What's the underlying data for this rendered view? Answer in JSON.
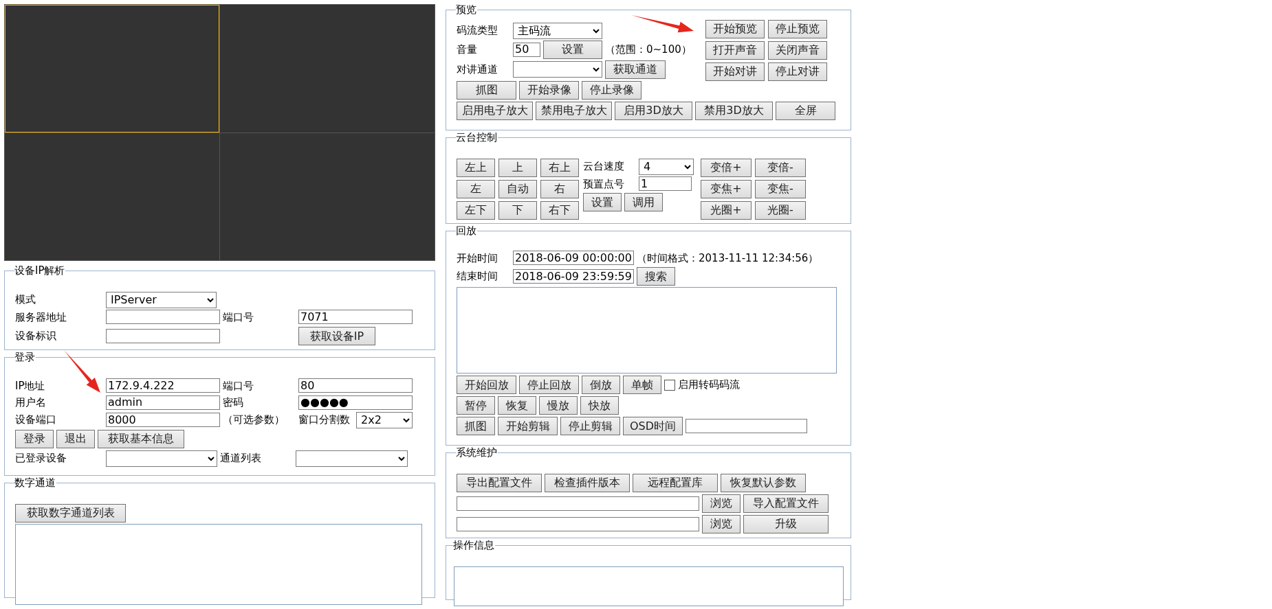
{
  "video_windows": [
    {
      "selected": true
    },
    {
      "selected": false
    },
    {
      "selected": false
    },
    {
      "selected": false
    }
  ],
  "device_ip": {
    "title": "设备IP解析",
    "mode_label": "模式",
    "mode_value": "IPServer",
    "server_label": "服务器地址",
    "port_label": "端口号",
    "port_value": "7071",
    "device_id_label": "设备标识",
    "get_ip_button": "获取设备IP"
  },
  "login": {
    "title": "登录",
    "ip_label": "IP地址",
    "ip_value": "172.9.4.222",
    "port_label": "端口号",
    "port_value": "80",
    "user_label": "用户名",
    "user_value": "admin",
    "password_label": "密码",
    "password_value": "●●●●●",
    "device_port_label": "设备端口",
    "device_port_value": "8000",
    "device_port_note": "（可选参数）",
    "split_label": "窗口分割数",
    "split_value": "2x2",
    "buttons": [
      "登录",
      "退出",
      "获取基本信息"
    ],
    "logged_devices_label": "已登录设备",
    "channel_list_label": "通道列表"
  },
  "digital_channels": {
    "title": "数字通道",
    "button": "获取数字通道列表"
  },
  "preview": {
    "title": "预览",
    "stream_label": "码流类型",
    "stream_value": "主码流",
    "volume_label": "音量",
    "volume_value": "50",
    "volume_button": "设置",
    "volume_note": "（范围：0~100）",
    "talk_label": "对讲通道",
    "talk_button": "获取通道",
    "side_buttons": [
      "开始预览",
      "停止预览",
      "打开声音",
      "关闭声音",
      "开始对讲",
      "停止对讲"
    ],
    "record_buttons": [
      "抓图",
      "开始录像",
      "停止录像"
    ],
    "zoom_buttons": [
      "启用电子放大",
      "禁用电子放大",
      "启用3D放大",
      "禁用3D放大",
      "全屏"
    ]
  },
  "ptz": {
    "title": "云台控制",
    "direction_buttons": [
      "左上",
      "上",
      "右上",
      "左",
      "自动",
      "右",
      "左下",
      "下",
      "右下"
    ],
    "speed_label": "云台速度",
    "speed_value": "4",
    "preset_label": "预置点号",
    "preset_value": "1",
    "preset_buttons": [
      "设置",
      "调用"
    ],
    "lens_buttons": [
      "变倍+",
      "变倍-",
      "变焦+",
      "变焦-",
      "光圈+",
      "光圈-"
    ]
  },
  "playback": {
    "title": "回放",
    "start_label": "开始时间",
    "start_value": "2018-06-09 00:00:00",
    "format_note": "（时间格式：2013-11-11 12:34:56）",
    "end_label": "结束时间",
    "end_value": "2018-06-09 23:59:59",
    "search_button": "搜索",
    "control_buttons": [
      "开始回放",
      "停止回放",
      "倒放",
      "单帧"
    ],
    "transcode": {
      "label": "启用转码码流",
      "checked": false
    },
    "speed_buttons": [
      "暂停",
      "恢复",
      "慢放",
      "快放"
    ],
    "clip_buttons": [
      "抓图",
      "开始剪辑",
      "停止剪辑",
      "OSD时间"
    ]
  },
  "maintenance": {
    "title": "系统维护",
    "buttons": [
      "导出配置文件",
      "检查插件版本",
      "远程配置库",
      "恢复默认参数"
    ],
    "browse_buttons": [
      "浏览",
      "浏览"
    ],
    "import_button": "导入配置文件",
    "upgrade_button": "升级"
  },
  "operation_info": {
    "title": "操作信息"
  }
}
